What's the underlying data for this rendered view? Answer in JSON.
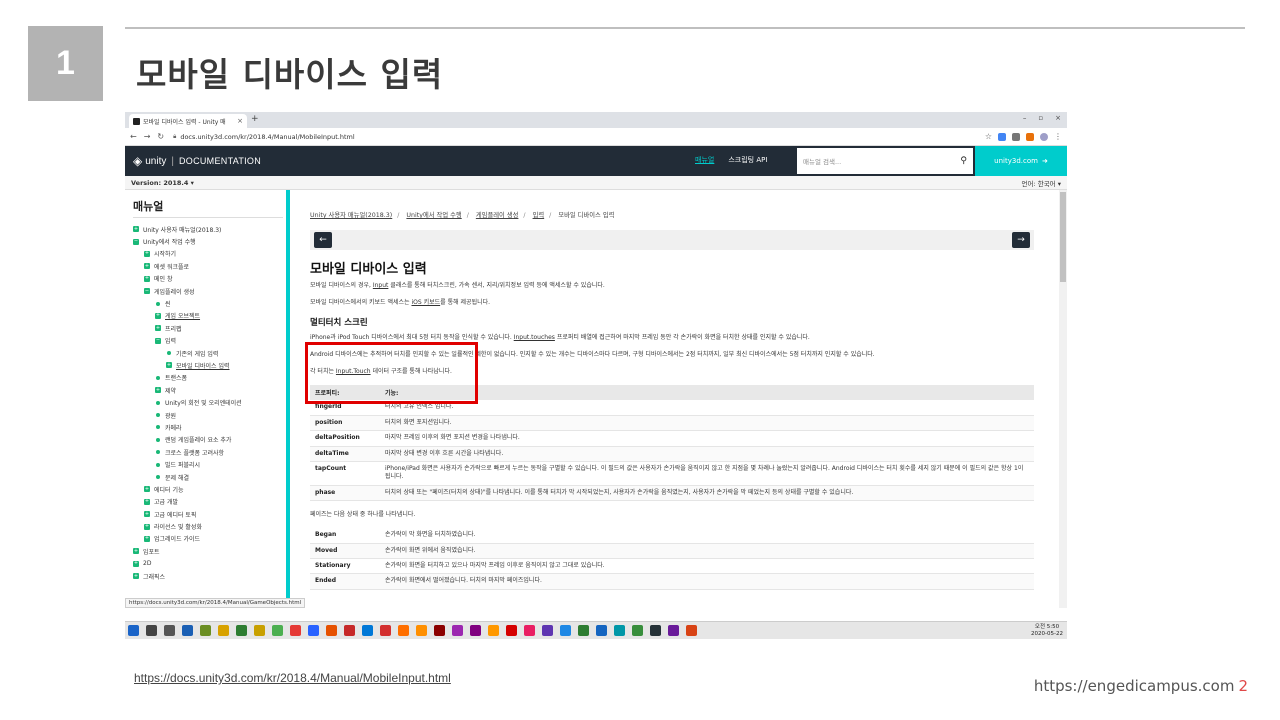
{
  "slide": {
    "number": "1",
    "title": "모바일 디바이스 입력",
    "link": "https://docs.unity3d.com/kr/2018.4/Manual/MobileInput.html",
    "footer_site": "https://engedicampus.com",
    "footer_page": "2"
  },
  "browser": {
    "tab_title": "모바일 디바이스 입력 - Unity 매",
    "new_tab": "+",
    "url": "docs.unity3d.com/kr/2018.4/Manual/MobileInput.html",
    "status_url": "https://docs.unity3d.com/kr/2018.4/Manual/GameObjects.html"
  },
  "header": {
    "logo": "unity",
    "product": "DOCUMENTATION",
    "nav_manual": "매뉴얼",
    "nav_script_api": "스크립팅 API",
    "search_placeholder": "매뉴얼 검색...",
    "site_button": "unity3d.com"
  },
  "version_bar": {
    "version": "Version: 2018.4 ▾",
    "language": "언어: 한국어 ▾"
  },
  "sidebar": {
    "title": "매뉴얼",
    "items": [
      {
        "label": "Unity 사용자 매뉴얼(2018.3)",
        "icon": "plus",
        "indent": 0
      },
      {
        "label": "Unity에서 작업 수행",
        "icon": "minus",
        "indent": 0
      },
      {
        "label": "시작하기",
        "icon": "plus",
        "indent": 1
      },
      {
        "label": "에셋 워크플로",
        "icon": "plus",
        "indent": 1
      },
      {
        "label": "메인 창",
        "icon": "plus",
        "indent": 1
      },
      {
        "label": "게임플레이 생성",
        "icon": "minus",
        "indent": 1
      },
      {
        "label": "씬",
        "icon": "dot",
        "indent": 2
      },
      {
        "label": "게임 오브젝트",
        "icon": "plus",
        "indent": 2
      },
      {
        "label": "프리팹",
        "icon": "plus",
        "indent": 2
      },
      {
        "label": "입력",
        "icon": "minus",
        "indent": 2
      },
      {
        "label": "기존의 게임 입력",
        "icon": "dot",
        "indent": 3
      },
      {
        "label": "모바일 디바이스 입력",
        "icon": "plus",
        "indent": 3
      },
      {
        "label": "트랜스폼",
        "icon": "dot",
        "indent": 2
      },
      {
        "label": "제약",
        "icon": "plus",
        "indent": 2
      },
      {
        "label": "Unity의 회전 및 오리엔테이션",
        "icon": "dot",
        "indent": 2
      },
      {
        "label": "광원",
        "icon": "dot",
        "indent": 2
      },
      {
        "label": "카메라",
        "icon": "dot",
        "indent": 2
      },
      {
        "label": "랜덤 게임플레이 요소 추가",
        "icon": "dot",
        "indent": 2
      },
      {
        "label": "크로스 플랫폼 고려사항",
        "icon": "dot",
        "indent": 2
      },
      {
        "label": "빌드 퍼블리시",
        "icon": "dot",
        "indent": 2
      },
      {
        "label": "문제 해결",
        "icon": "dot",
        "indent": 2
      },
      {
        "label": "에디터 기능",
        "icon": "plus",
        "indent": 1
      },
      {
        "label": "고급 개발",
        "icon": "plus",
        "indent": 1
      },
      {
        "label": "고급 에디터 토픽",
        "icon": "plus",
        "indent": 1
      },
      {
        "label": "라이선스 및 활성화",
        "icon": "plus",
        "indent": 1
      },
      {
        "label": "업그레이드 가이드",
        "icon": "plus",
        "indent": 1
      },
      {
        "label": "임포트",
        "icon": "plus",
        "indent": 0
      },
      {
        "label": "2D",
        "icon": "plus",
        "indent": 0
      },
      {
        "label": "그래픽스",
        "icon": "plus",
        "indent": 0
      }
    ]
  },
  "content": {
    "breadcrumb": [
      "Unity 사용자 매뉴얼(2018.3)",
      "Unity에서 작업 수행",
      "게임플레이 생성",
      "입력",
      "모바일 디바이스 입력"
    ],
    "prev_button": "←",
    "next_button": "→",
    "title": "모바일 디바이스 입력",
    "intro_1a": "모바일 디바이스의 경우, ",
    "intro_1_link": "Input",
    "intro_1b": " 클래스를 통해 터치스크린, 가속 센서, 지리/위치정보 입력 등에 액세스할 수 있습니다.",
    "intro_2a": "모바일 디바이스에서의 키보드 액세스는 ",
    "intro_2_link": "iOS 키보드",
    "intro_2b": "를 통해 제공됩니다.",
    "multitouch_heading": "멀티터치 스크린",
    "mt_p1a": "iPhone과 iPod Touch 디바이스에서 최대 5정 터치 동작을 인식할 수 있습니다. ",
    "mt_p1_link": "Input.touches",
    "mt_p1b": " 프로퍼티 배열에 접근하여 마지막 프레임 동안 각 손가락이 화면을 터치한 상태를 인지할 수 있습니다.",
    "mt_p2": "Android 디바이스에는 추적하여 터치를 인지할 수 있는 일률적인 제한이 없습니다. 인지할 수 있는 개수는 디바이스마다 다르며, 구형 디바이스에서는 2점 터치까지, 일부 최신 디바이스에서는 5점 터치까지 인지할 수 있습니다.",
    "mt_p3a": "각 터치는 ",
    "mt_p3_link": "Input.Touch",
    "mt_p3b": " 데이터 구조를 통해 나타납니다.",
    "props_header": [
      "프로퍼티:",
      "기능:"
    ],
    "props": [
      [
        "fingerId",
        "터치의 고유 인덱스 입니다."
      ],
      [
        "position",
        "터치의 화면 포지션입니다."
      ],
      [
        "deltaPosition",
        "마지막 프레임 이후의 화면 포지션 변경을 나타냅니다."
      ],
      [
        "deltaTime",
        "마지막 상태 변경 이후 흐른 시간을 나타냅니다."
      ],
      [
        "tapCount",
        "iPhone/iPad 화면은 사용자가 손가락으로 빠르게 누르는 동작을 구별할 수 있습니다. 이 필드의 값은 사용자가 손가락을 움직이지 않고 한 지점을 몇 차례나 눌렀는지 알려줍니다. Android 디바이스는 터치 횟수를 세지 않기 때문에 이 필드의 값은 항상 1이 됩니다."
      ],
      [
        "phase",
        "터치의 상태 또는 \"페이즈(터치의 상태)\"를 나타냅니다. 이를 통해 터치가 막 시작되었는지, 사용자가 손가락을 움직였는지, 사용자가 손가락을 막 떼었는지 등의 상태를 구별할 수 있습니다."
      ]
    ],
    "phase_intro": "페이즈는 다음 상태 중 하나를 나타냅니다.",
    "phases": [
      [
        "Began",
        "손가락이 막 화면을 터치하였습니다."
      ],
      [
        "Moved",
        "손가락이 화면 위에서 움직였습니다."
      ],
      [
        "Stationary",
        "손가락이 화면을 터치하고 있으나 마지막 프레임 이후로 움직이지 않고 그대로 있습니다."
      ],
      [
        "Ended",
        "손가락이 화면에서 떨어졌습니다. 터치의 마지막 페이즈입니다."
      ]
    ]
  },
  "taskbar": {
    "time": "오전 5:50",
    "date": "2020-05-22",
    "icon_colors": [
      "#1a64c8",
      "#444444",
      "#555555",
      "#1a5fb4",
      "#6b8e23",
      "#d8a200",
      "#2e7d32",
      "#c8a000",
      "#4caf50",
      "#e53935",
      "#2962ff",
      "#e65100",
      "#c62828",
      "#0078d7",
      "#d32f2f",
      "#ff6f00",
      "#ff8f00",
      "#8b0000",
      "#9c27b0",
      "#800080",
      "#ff9800",
      "#d50000",
      "#e91e63",
      "#5e35b1",
      "#1e88e5",
      "#2e7d32",
      "#1565c0",
      "#0097a7",
      "#388e3c",
      "#263238",
      "#6a1b9a",
      "#d84315"
    ]
  },
  "colors": {
    "unity_header": "#222c37",
    "accent": "#00cccc",
    "highlight_box": "#e00000"
  }
}
